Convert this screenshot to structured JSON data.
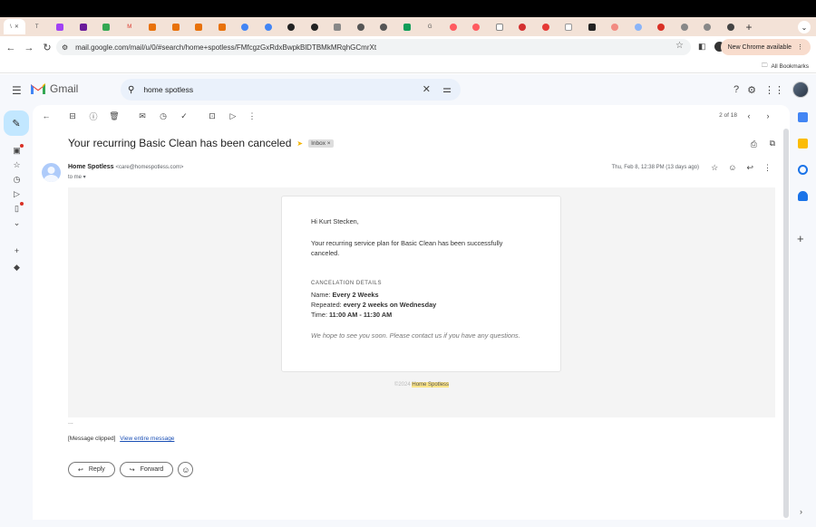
{
  "browser": {
    "tabs": [
      "\\",
      "T",
      "G",
      "",
      "T",
      "M",
      "E",
      "E",
      "E",
      "E",
      "",
      "",
      "",
      "",
      "",
      "",
      "",
      "G",
      "",
      "",
      "",
      "",
      "",
      "",
      "",
      "",
      "",
      "",
      ""
    ],
    "new_tab_label": "+",
    "url": "mail.google.com/mail/u/0/#search/home+spotless/FMfcgzGxRdxBwpkBlDTBMkMRqhGCmrXt",
    "new_chrome_label": "New Chrome available",
    "all_bookmarks": "All Bookmarks"
  },
  "gmail": {
    "logo_text": "Gmail",
    "search_query": "home spotless",
    "pager": "2 of 18"
  },
  "email": {
    "subject": "Your recurring Basic Clean has been canceled",
    "label": "Inbox ×",
    "sender_name": "Home Spotless",
    "sender_email": "<care@homespotless.com>",
    "to": "to me ▾",
    "date": "Thu, Feb 8, 12:38 PM (13 days ago)",
    "greeting": "Hi Kurt Stecken,",
    "intro": "Your recurring service plan for Basic Clean has been successfully canceled.",
    "section_title": "CANCELATION DETAILS",
    "details": [
      {
        "label": "Name: ",
        "value": "Every 2 Weeks"
      },
      {
        "label": "Repeated: ",
        "value": "every 2 weeks on Wednesday"
      },
      {
        "label": "Time: ",
        "value": "11:00 AM - 11:30 AM"
      }
    ],
    "closing": "We hope to see you soon. Please contact us if you have any questions.",
    "copyright_prefix": "©2024",
    "copyright_brand": "Home Spotless",
    "ellipsis": "...",
    "clipped_text": "[Message clipped]",
    "clipped_link": "View entire message",
    "reply_label": "Reply",
    "forward_label": "Forward"
  },
  "colors": {
    "compose_bg": "#c2e7ff",
    "search_bg": "#eaf1fb",
    "app_bg": "#f6f8fc",
    "highlight": "#fce58a"
  }
}
